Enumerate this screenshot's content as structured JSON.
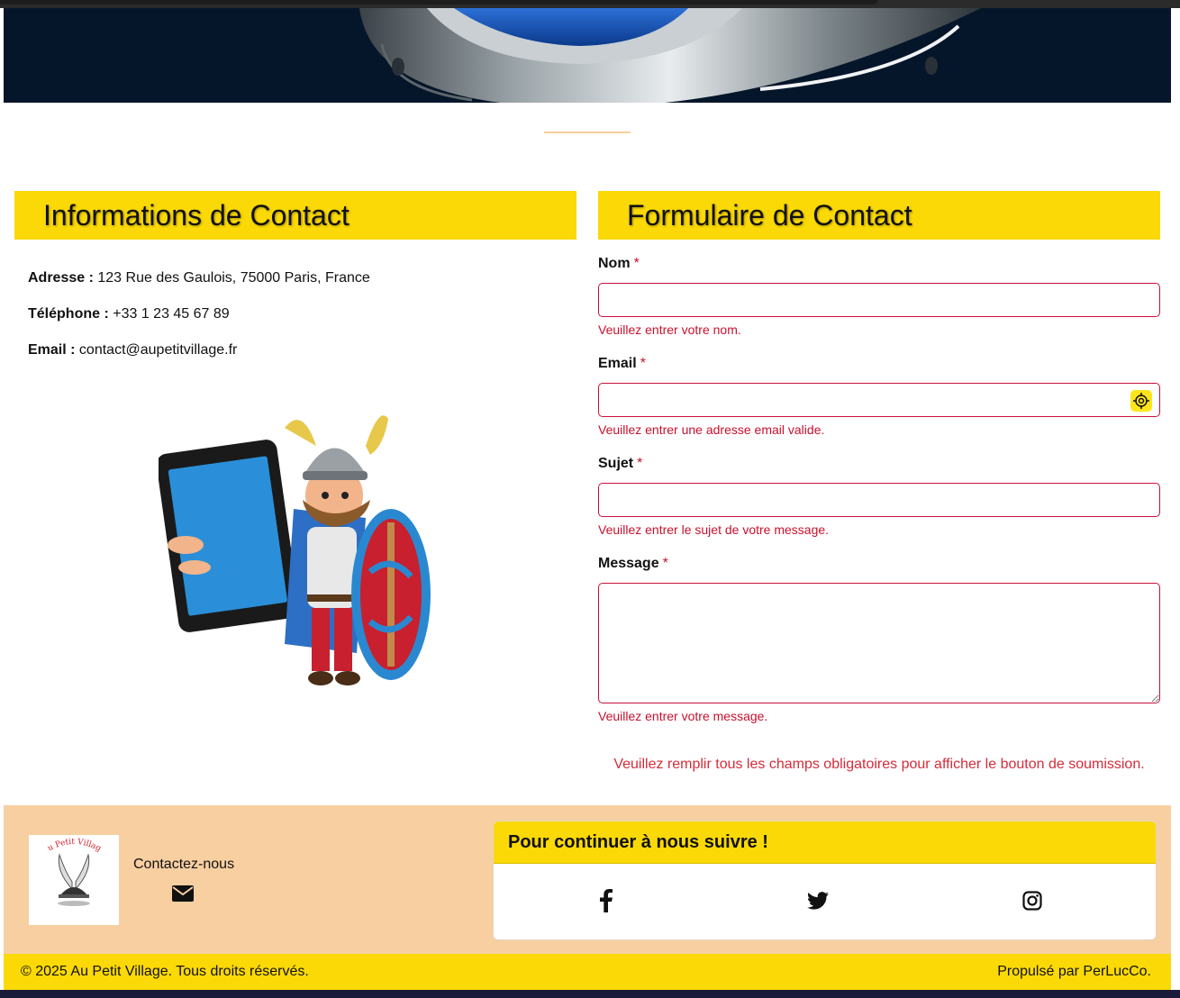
{
  "colors": {
    "accent_yellow": "#fbd906",
    "footer_peach": "#f7cfa1",
    "error_red": "#c8102e",
    "hero_navy": "#06162a"
  },
  "hero": {
    "image": "helmet-banner"
  },
  "contact_info": {
    "title": "Informations de Contact",
    "address_label": "Adresse :",
    "address_value": "123 Rue des Gaulois, 75000 Paris, France",
    "phone_label": "Téléphone :",
    "phone_value": "+33 1 23 45 67 89",
    "email_label": "Email :",
    "email_value": "contact@aupetitvillage.fr",
    "illustration": "gaulish-warrior-with-phone"
  },
  "contact_form": {
    "title": "Formulaire de Contact",
    "required_mark": "*",
    "fields": {
      "name": {
        "label": "Nom",
        "value": "",
        "error": "Veuillez entrer votre nom."
      },
      "email": {
        "label": "Email",
        "value": "",
        "error": "Veuillez entrer une adresse email valide.",
        "autofill_icon": "crosshair-icon"
      },
      "subject": {
        "label": "Sujet",
        "value": "",
        "error": "Veuillez entrer le sujet de votre message."
      },
      "message": {
        "label": "Message",
        "value": "",
        "error": "Veuillez entrer votre message."
      }
    },
    "submit_note": "Veuillez remplir tous les champs obligatoires pour afficher le bouton de soumission."
  },
  "footer": {
    "logo_text": "Au Petit Village",
    "contact_label": "Contactez-nous",
    "mail_icon": "envelope-icon",
    "follow_title": "Pour continuer à nous suivre !",
    "socials": [
      "facebook-icon",
      "twitter-icon",
      "instagram-icon"
    ],
    "copyright": "© 2025 Au Petit Village. Tous droits réservés.",
    "powered_by": "Propulsé par PerLucCo."
  }
}
